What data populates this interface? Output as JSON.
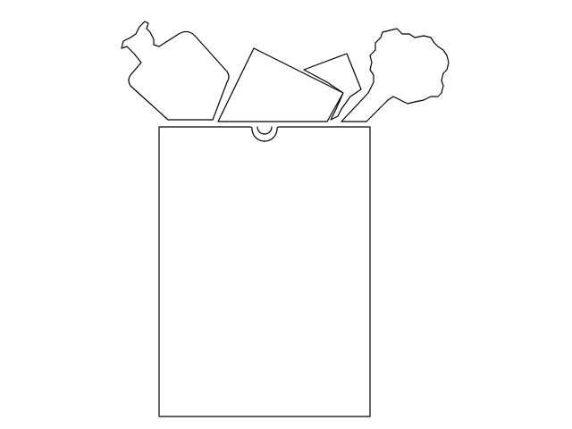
{
  "background_color": "#ffffff",
  "line_color": "#000000",
  "illustration": {
    "subject": "grocery-bag",
    "items": [
      "bottle-icon",
      "box-icon",
      "carton-icon",
      "broccoli-icon"
    ]
  }
}
